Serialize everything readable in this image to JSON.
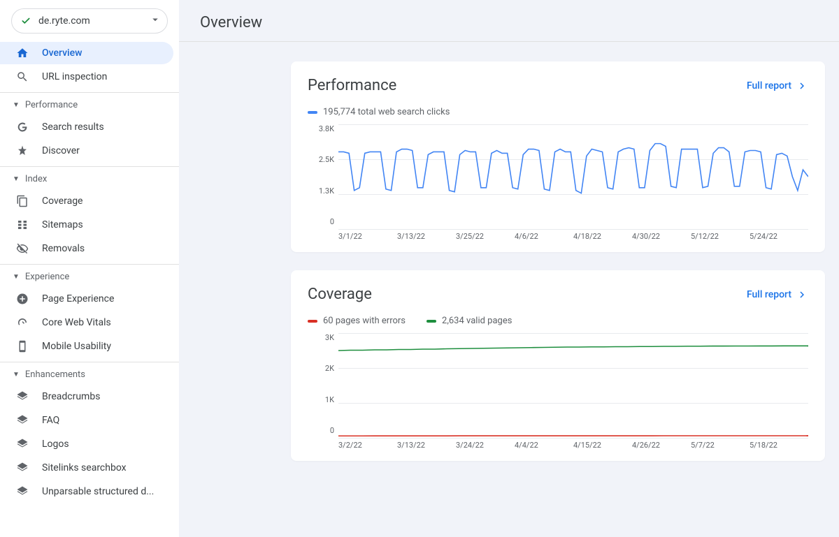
{
  "property": {
    "domain": "de.ryte.com"
  },
  "page_title": "Overview",
  "sidebar": {
    "main": [
      {
        "label": "Overview",
        "icon": "home",
        "active": true
      },
      {
        "label": "URL inspection",
        "icon": "search"
      }
    ],
    "sections": [
      {
        "title": "Performance",
        "items": [
          {
            "label": "Search results",
            "icon": "g"
          },
          {
            "label": "Discover",
            "icon": "star"
          }
        ]
      },
      {
        "title": "Index",
        "items": [
          {
            "label": "Coverage",
            "icon": "copy"
          },
          {
            "label": "Sitemaps",
            "icon": "sitemap"
          },
          {
            "label": "Removals",
            "icon": "visibility-off"
          }
        ]
      },
      {
        "title": "Experience",
        "items": [
          {
            "label": "Page Experience",
            "icon": "plus-circle"
          },
          {
            "label": "Core Web Vitals",
            "icon": "gauge"
          },
          {
            "label": "Mobile Usability",
            "icon": "phone"
          }
        ]
      },
      {
        "title": "Enhancements",
        "items": [
          {
            "label": "Breadcrumbs",
            "icon": "layers"
          },
          {
            "label": "FAQ",
            "icon": "layers"
          },
          {
            "label": "Logos",
            "icon": "layers"
          },
          {
            "label": "Sitelinks searchbox",
            "icon": "layers"
          },
          {
            "label": "Unparsable structured d...",
            "icon": "layers"
          }
        ]
      }
    ]
  },
  "performance": {
    "title": "Performance",
    "full_report": "Full report",
    "legend": "195,774 total web search clicks"
  },
  "coverage": {
    "title": "Coverage",
    "full_report": "Full report",
    "legend_errors": "60 pages with errors",
    "legend_valid": "2,634 valid pages"
  },
  "chart_data": [
    {
      "type": "line",
      "id": "performance",
      "title": "Performance",
      "ylabel": "clicks",
      "ylim": [
        0,
        3800
      ],
      "y_ticks": [
        "3.8K",
        "2.5K",
        "1.3K",
        "0"
      ],
      "x_ticks": [
        "3/1/22",
        "3/13/22",
        "3/25/22",
        "4/6/22",
        "4/18/22",
        "4/30/22",
        "5/12/22",
        "5/24/22"
      ],
      "series": [
        {
          "name": "total web search clicks",
          "color": "#4285f4",
          "values": [
            2800,
            2800,
            2750,
            1400,
            1500,
            2750,
            2800,
            2800,
            2800,
            1450,
            1400,
            2800,
            2900,
            2900,
            2850,
            1500,
            1500,
            2700,
            2800,
            2800,
            2800,
            1400,
            1350,
            2700,
            2850,
            2800,
            2800,
            1500,
            1500,
            2750,
            2850,
            2750,
            2750,
            1500,
            1450,
            2700,
            2900,
            2900,
            2850,
            1450,
            1400,
            2800,
            2900,
            2800,
            2800,
            1400,
            1300,
            2650,
            2900,
            2850,
            2800,
            1500,
            1450,
            2800,
            2900,
            2950,
            2900,
            1500,
            1500,
            2850,
            3100,
            3100,
            3000,
            1550,
            1500,
            2900,
            2900,
            2900,
            2900,
            1500,
            1550,
            2750,
            2950,
            2950,
            2800,
            1550,
            1550,
            2800,
            2850,
            2850,
            2800,
            1500,
            1450,
            2700,
            2750,
            2650,
            1900,
            1400,
            2150,
            1900
          ]
        }
      ]
    },
    {
      "type": "line",
      "id": "coverage",
      "title": "Coverage",
      "ylabel": "pages",
      "ylim": [
        0,
        3000
      ],
      "y_ticks": [
        "3K",
        "2K",
        "1K",
        "0"
      ],
      "x_ticks": [
        "3/2/22",
        "3/13/22",
        "3/24/22",
        "4/4/22",
        "4/15/22",
        "4/26/22",
        "5/7/22",
        "5/18/22"
      ],
      "series": [
        {
          "name": "valid pages",
          "color": "#1e8e3e",
          "values": [
            2500,
            2510,
            2510,
            2520,
            2520,
            2530,
            2530,
            2540,
            2540,
            2550,
            2555,
            2560,
            2565,
            2570,
            2575,
            2580,
            2585,
            2590,
            2595,
            2600,
            2600,
            2605,
            2605,
            2610,
            2610,
            2615,
            2615,
            2620,
            2620,
            2625,
            2625,
            2628,
            2628,
            2630,
            2630,
            2632,
            2632,
            2634,
            2634,
            2634
          ]
        },
        {
          "name": "pages with errors",
          "color": "#d93025",
          "values": [
            55,
            55,
            55,
            56,
            56,
            56,
            57,
            57,
            57,
            57,
            58,
            58,
            58,
            58,
            58,
            58,
            58,
            59,
            59,
            59,
            59,
            59,
            59,
            59,
            59,
            59,
            59,
            60,
            60,
            60,
            60,
            60,
            60,
            60,
            60,
            60,
            60,
            60,
            60,
            60
          ]
        }
      ]
    }
  ]
}
